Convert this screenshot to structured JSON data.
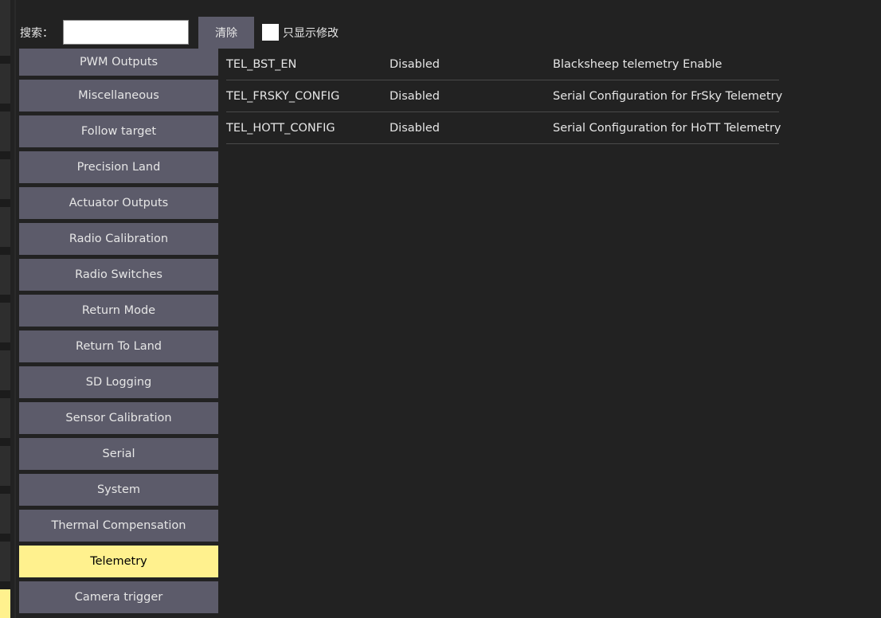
{
  "search": {
    "label": "搜索：",
    "value": "",
    "placeholder": "",
    "clear_label": "清除",
    "modified_only_label": "只显示修改",
    "modified_only_checked": false
  },
  "groups": [
    {
      "label": "PWM Outputs"
    },
    {
      "label": "Miscellaneous"
    },
    {
      "label": "Follow target"
    },
    {
      "label": "Precision Land"
    },
    {
      "label": "Actuator Outputs"
    },
    {
      "label": "Radio Calibration"
    },
    {
      "label": "Radio Switches"
    },
    {
      "label": "Return Mode"
    },
    {
      "label": "Return To Land"
    },
    {
      "label": "SD Logging"
    },
    {
      "label": "Sensor Calibration"
    },
    {
      "label": "Serial"
    },
    {
      "label": "System"
    },
    {
      "label": "Thermal Compensation"
    },
    {
      "label": "Telemetry"
    },
    {
      "label": "Camera trigger"
    }
  ],
  "selected_group": "Telemetry",
  "params": [
    {
      "name": "TEL_BST_EN",
      "value": "Disabled",
      "description": "Blacksheep telemetry Enable"
    },
    {
      "name": "TEL_FRSKY_CONFIG",
      "value": "Disabled",
      "description": "Serial Configuration for FrSky Telemetry"
    },
    {
      "name": "TEL_HOTT_CONFIG",
      "value": "Disabled",
      "description": "Serial Configuration for HoTT Telemetry"
    }
  ],
  "colors": {
    "background": "#222222",
    "button": "#5c5b6a",
    "selected": "#fff18e",
    "text": "#e6e6e6"
  }
}
